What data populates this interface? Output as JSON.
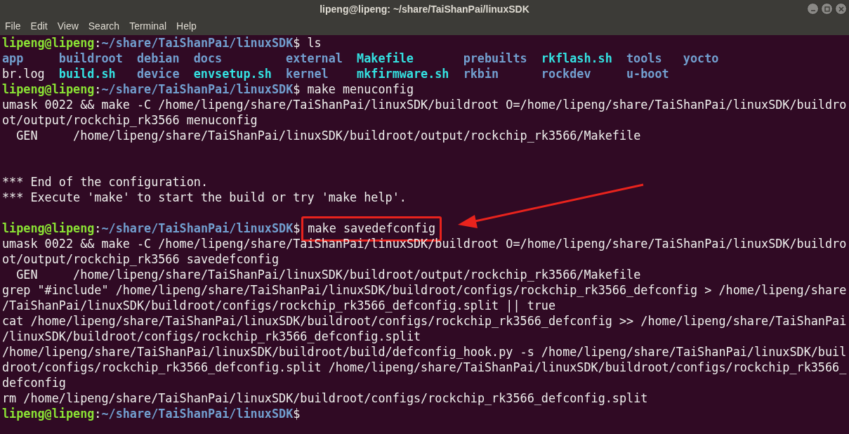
{
  "window": {
    "title": "lipeng@lipeng: ~/share/TaiShanPai/linuxSDK"
  },
  "menu": [
    "File",
    "Edit",
    "View",
    "Search",
    "Terminal",
    "Help"
  ],
  "lines": [
    {
      "kind": "prompt",
      "segments": [
        {
          "kind": "user",
          "text": "lipeng@lipeng"
        },
        {
          "kind": "plain",
          "text": ":"
        },
        {
          "kind": "path",
          "text": "~/share/TaiShanPai/linuxSDK"
        },
        {
          "kind": "plain",
          "text": "$"
        }
      ],
      "command": "ls",
      "highlighted": false
    },
    {
      "kind": "listing",
      "items": [
        {
          "name": "app",
          "kind": "dir"
        },
        {
          "name": "buildroot",
          "kind": "dir"
        },
        {
          "name": "debian",
          "kind": "dir"
        },
        {
          "name": "docs",
          "kind": "dir"
        },
        {
          "name": "external",
          "kind": "dir"
        },
        {
          "name": "Makefile",
          "kind": "exec"
        },
        {
          "name": "prebuilts",
          "kind": "dir"
        },
        {
          "name": "rkflash.sh",
          "kind": "exec"
        },
        {
          "name": "tools",
          "kind": "dir"
        },
        {
          "name": "yocto",
          "kind": "dir"
        },
        {
          "name": "br.log",
          "kind": "file"
        },
        {
          "name": "build.sh",
          "kind": "exec"
        },
        {
          "name": "device",
          "kind": "dir"
        },
        {
          "name": "envsetup.sh",
          "kind": "exec"
        },
        {
          "name": "kernel",
          "kind": "dir"
        },
        {
          "name": "mkfirmware.sh",
          "kind": "exec"
        },
        {
          "name": "rkbin",
          "kind": "dir"
        },
        {
          "name": "rockdev",
          "kind": "dir"
        },
        {
          "name": "u-boot",
          "kind": "dir"
        }
      ]
    },
    {
      "kind": "prompt",
      "segments": [
        {
          "kind": "user",
          "text": "lipeng@lipeng"
        },
        {
          "kind": "plain",
          "text": ":"
        },
        {
          "kind": "path",
          "text": "~/share/TaiShanPai/linuxSDK"
        },
        {
          "kind": "plain",
          "text": "$"
        }
      ],
      "command": "make menuconfig",
      "highlighted": false
    },
    {
      "kind": "output",
      "text": "umask 0022 && make -C /home/lipeng/share/TaiShanPai/linuxSDK/buildroot O=/home/lipeng/share/TaiShanPai/linuxSDK/buildro"
    },
    {
      "kind": "output",
      "text": "ot/output/rockchip_rk3566 menuconfig"
    },
    {
      "kind": "output",
      "text": "  GEN     /home/lipeng/share/TaiShanPai/linuxSDK/buildroot/output/rockchip_rk3566/Makefile"
    },
    {
      "kind": "blank"
    },
    {
      "kind": "blank"
    },
    {
      "kind": "output",
      "text": "*** End of the configuration."
    },
    {
      "kind": "output",
      "text": "*** Execute 'make' to start the build or try 'make help'."
    },
    {
      "kind": "blank"
    },
    {
      "kind": "prompt",
      "segments": [
        {
          "kind": "user",
          "text": "lipeng@lipeng"
        },
        {
          "kind": "plain",
          "text": ":"
        },
        {
          "kind": "path",
          "text": "~/share/TaiShanPai/linuxSDK"
        },
        {
          "kind": "plain",
          "text": "$"
        }
      ],
      "command": "make savedefconfig",
      "highlighted": true
    },
    {
      "kind": "output",
      "text": "umask 0022 && make -C /home/lipeng/share/TaiShanPai/linuxSDK/buildroot O=/home/lipeng/share/TaiShanPai/linuxSDK/buildro"
    },
    {
      "kind": "output",
      "text": "ot/output/rockchip_rk3566 savedefconfig"
    },
    {
      "kind": "output",
      "text": "  GEN     /home/lipeng/share/TaiShanPai/linuxSDK/buildroot/output/rockchip_rk3566/Makefile"
    },
    {
      "kind": "output",
      "text": "grep \"#include\" /home/lipeng/share/TaiShanPai/linuxSDK/buildroot/configs/rockchip_rk3566_defconfig > /home/lipeng/share"
    },
    {
      "kind": "output",
      "text": "/TaiShanPai/linuxSDK/buildroot/configs/rockchip_rk3566_defconfig.split || true"
    },
    {
      "kind": "output",
      "text": "cat /home/lipeng/share/TaiShanPai/linuxSDK/buildroot/configs/rockchip_rk3566_defconfig >> /home/lipeng/share/TaiShanPai"
    },
    {
      "kind": "output",
      "text": "/linuxSDK/buildroot/configs/rockchip_rk3566_defconfig.split"
    },
    {
      "kind": "output",
      "text": "/home/lipeng/share/TaiShanPai/linuxSDK/buildroot/build/defconfig_hook.py -s /home/lipeng/share/TaiShanPai/linuxSDK/buil"
    },
    {
      "kind": "output",
      "text": "droot/configs/rockchip_rk3566_defconfig.split /home/lipeng/share/TaiShanPai/linuxSDK/buildroot/configs/rockchip_rk3566_"
    },
    {
      "kind": "output",
      "text": "defconfig"
    },
    {
      "kind": "output",
      "text": "rm /home/lipeng/share/TaiShanPai/linuxSDK/buildroot/configs/rockchip_rk3566_defconfig.split"
    },
    {
      "kind": "prompt",
      "segments": [
        {
          "kind": "user",
          "text": "lipeng@lipeng"
        },
        {
          "kind": "plain",
          "text": ":"
        },
        {
          "kind": "path",
          "text": "~/share/TaiShanPai/linuxSDK"
        },
        {
          "kind": "plain",
          "text": "$"
        }
      ]
    }
  ]
}
